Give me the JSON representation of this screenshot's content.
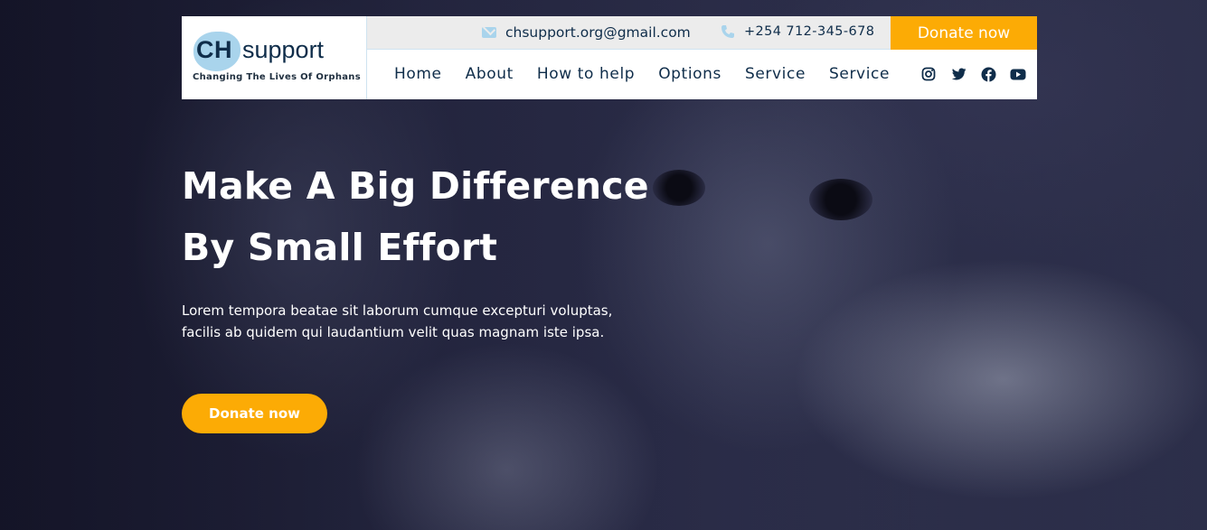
{
  "brand": {
    "logo_ch": "CH",
    "logo_support": "support",
    "tagline": "Changing The Lives Of Orphans",
    "accent": "#fcab05",
    "navy": "#0f2d4a",
    "light_blue": "#a9d4ec"
  },
  "topbar": {
    "email_icon": "envelope-icon",
    "email": "chsupport.org@gmail.com",
    "phone_icon": "phone-icon",
    "phone": "+254 712-345-678",
    "donate_label": "Donate now"
  },
  "nav": {
    "items": [
      {
        "label": "Home"
      },
      {
        "label": "About"
      },
      {
        "label": "How to help"
      },
      {
        "label": "Options"
      },
      {
        "label": "Service"
      },
      {
        "label": "Service"
      }
    ],
    "socials": [
      "instagram-icon",
      "twitter-icon",
      "facebook-icon",
      "youtube-icon"
    ]
  },
  "hero": {
    "title_line1": "Make A Big Difference",
    "title_line2": "By Small Effort",
    "description": "Lorem tempora beatae sit laborum cumque excepturi voluptas, facilis ab quidem qui laudantium velit quas magnam iste ipsa.",
    "donate_label": "Donate now",
    "background_image": "photo-of-two-children"
  }
}
